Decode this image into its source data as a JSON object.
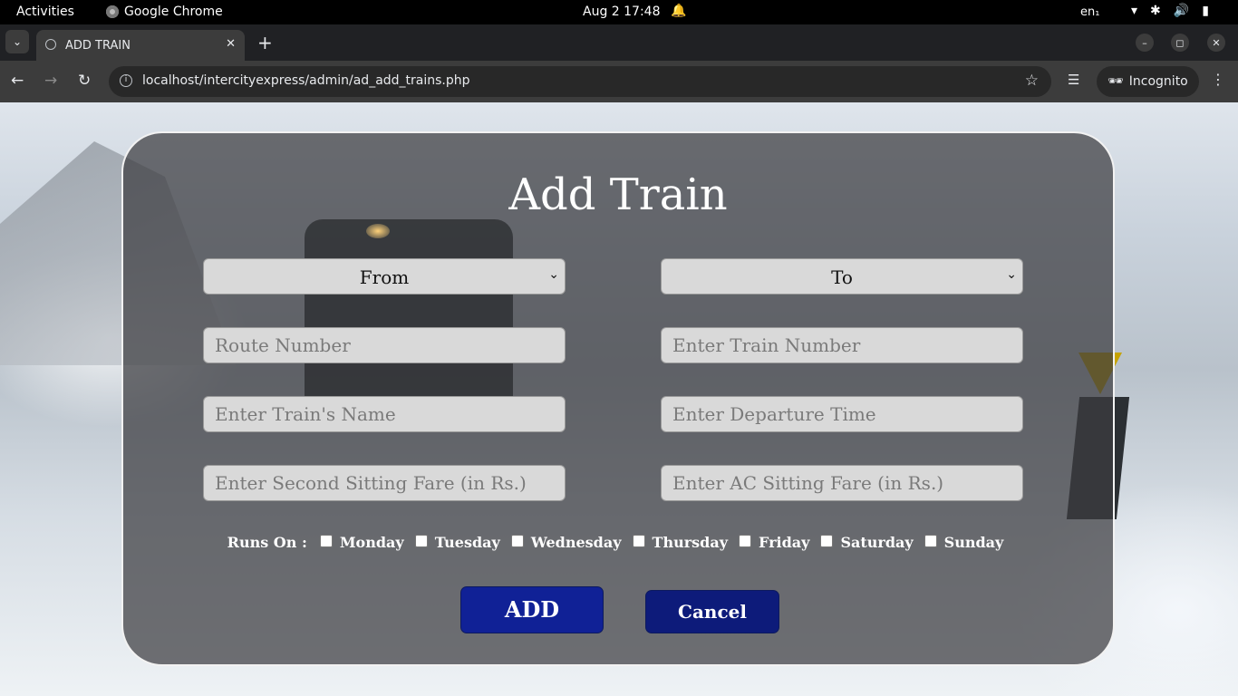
{
  "topbar": {
    "activities": "Activities",
    "app_name": "Google Chrome",
    "datetime": "Aug 2  17:48",
    "lang": "en₁"
  },
  "browser": {
    "tab_title": "ADD TRAIN",
    "url": "localhost/intercityexpress/admin/ad_add_trains.php",
    "incognito_label": "Incognito"
  },
  "form": {
    "heading": "Add Train",
    "from_select": "From",
    "to_select": "To",
    "route_placeholder": "Route Number",
    "train_number_placeholder": "Enter Train Number",
    "train_name_placeholder": "Enter Train's Name",
    "departure_placeholder": "Enter Departure Time",
    "second_fare_placeholder": "Enter Second Sitting Fare (in Rs.)",
    "ac_fare_placeholder": "Enter AC Sitting Fare (in Rs.)",
    "runs_on_label": "Runs On :",
    "days": [
      "Monday",
      "Tuesday",
      "Wednesday",
      "Thursday",
      "Friday",
      "Saturday",
      "Sunday"
    ],
    "add_button": "ADD",
    "cancel_button": "Cancel"
  },
  "colors": {
    "add_button": "#102196",
    "cancel_button": "#0d1b7a",
    "card_overlay": "#3c3c40"
  }
}
